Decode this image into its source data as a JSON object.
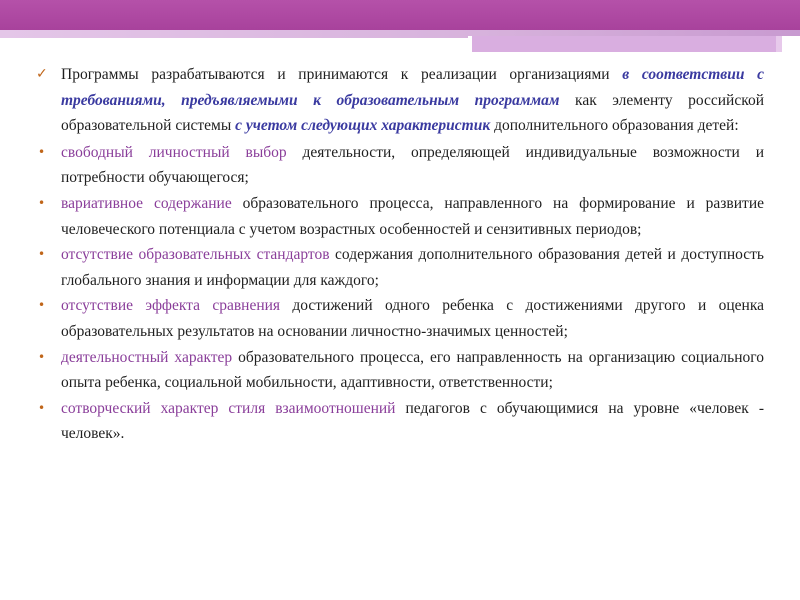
{
  "intro": {
    "t1": "Программы разрабатываются и принимаются к реализации организациями ",
    "e1": "в соответствии с требованиями, предъявляемыми к образовательным программам",
    "t2": " как элементу российской образовательной системы ",
    "e2": "с учетом следующих характеристик",
    "t3": " дополнительного образования детей:"
  },
  "items": [
    {
      "hl": "свободный личностный выбор",
      "text": " деятельности, определяющей индивидуальные возможности и потребности обучающегося;"
    },
    {
      "hl": "вариативное содержание",
      "text": " образовательного процесса, направленного на формирование и развитие человеческого потенциала с учетом возрастных особенностей и сензитивных периодов;"
    },
    {
      "hl": "отсутствие образовательных стандартов",
      "text": " содержания дополнительного образования детей и доступность глобального знания и информации для каждого;"
    },
    {
      "hl": "отсутствие эффекта сравнения",
      "text": " достижений одного ребенка с достижениями другого и оценка образовательных результатов на основании личностно-значимых ценностей;"
    },
    {
      "hl": "деятельностный характер",
      "text": " образовательного процесса, его направленность на организацию социального опыта ребенка, социальной мобильности, адаптивности, ответственности;"
    },
    {
      "hl": "сотворческий характер стиля взаимоотношений",
      "text": " педагогов с обучающимися на уровне «человек - человек»."
    }
  ],
  "colors": {
    "band": "#a8429c",
    "accent_blue": "#3a3aa0",
    "accent_purple": "#8a3e9a",
    "bullet": "#c0661a"
  },
  "icons": {
    "intro_marker": "checkmark-icon",
    "item_marker": "bullet-dot-icon"
  }
}
